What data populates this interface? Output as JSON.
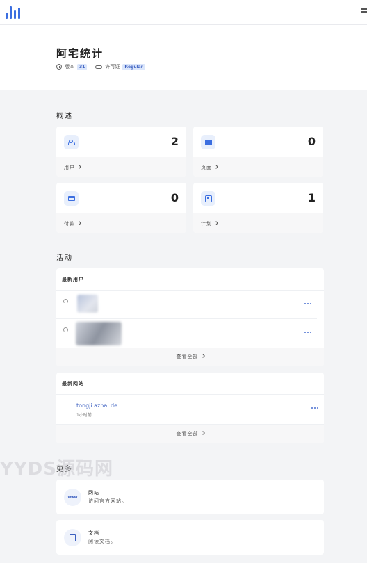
{
  "app": {
    "title": "阿宅统计",
    "version_label": "版本",
    "version_value": "31",
    "license_label": "许可证",
    "license_value": "Regular"
  },
  "overview": {
    "title": "概述",
    "stats": [
      {
        "icon": "users-icon",
        "value": "2",
        "link": "用户"
      },
      {
        "icon": "pages-icon",
        "value": "0",
        "link": "页面"
      },
      {
        "icon": "credit-card-icon",
        "value": "0",
        "link": "付款"
      },
      {
        "icon": "calendar-icon",
        "value": "1",
        "link": "计划"
      }
    ]
  },
  "activity": {
    "title": "活动",
    "latest_users": {
      "title": "最新用户",
      "view_all": "查看全部"
    },
    "latest_sites": {
      "title": "最新网站",
      "items": [
        {
          "name": "tongji.azhai.de",
          "time": "1小时前"
        }
      ],
      "view_all": "查看全部"
    }
  },
  "more": {
    "title": "更多",
    "links": [
      {
        "icon": "www-icon",
        "icon_text": "www",
        "title": "网站",
        "desc": "访问官方网站。"
      },
      {
        "icon": "book-icon",
        "title": "文档",
        "desc": "阅读文档。"
      }
    ]
  },
  "watermark": "YYDS源码网",
  "colors": {
    "accent": "#3b6ee0",
    "background": "#f3f4f6",
    "badge_bg": "#dbe6fb"
  }
}
